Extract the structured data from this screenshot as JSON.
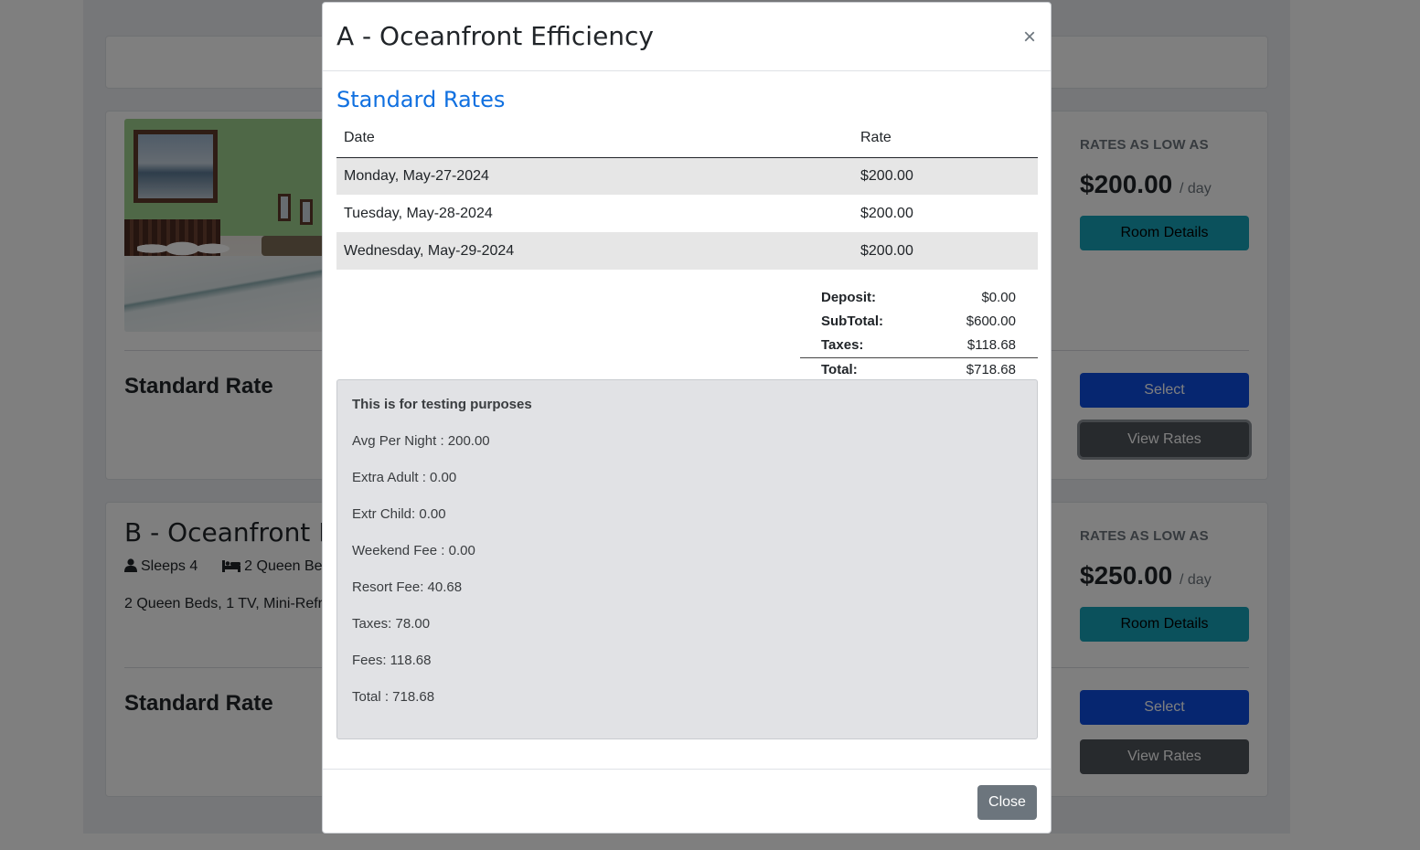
{
  "background": {
    "room_a": {
      "rate_name": "Standard Rate",
      "rates_low_label": "RATES AS LOW AS",
      "price": "$200.00",
      "per": "/ day",
      "room_details_label": "Room Details",
      "select_label": "Select",
      "view_rates_label": "View Rates"
    },
    "room_b": {
      "title": "B - Oceanfront Ro",
      "sleeps": "Sleeps 4",
      "beds": "2 Queen Beds",
      "description": "2 Queen Beds, 1 TV, Mini-Refri",
      "rate_name": "Standard Rate",
      "rates_low_label": "RATES AS LOW AS",
      "price": "$250.00",
      "per": "/ day",
      "room_details_label": "Room Details",
      "select_label": "Select",
      "view_rates_label": "View Rates"
    }
  },
  "modal": {
    "title": "A - Oceanfront Efficiency",
    "close_icon": "×",
    "section_title": "Standard Rates",
    "table": {
      "headers": [
        "Date",
        "Rate"
      ],
      "rows": [
        {
          "date": "Monday, May-27-2024",
          "rate": "$200.00"
        },
        {
          "date": "Tuesday, May-28-2024",
          "rate": "$200.00"
        },
        {
          "date": "Wednesday, May-29-2024",
          "rate": "$200.00"
        }
      ]
    },
    "totals": {
      "deposit_label": "Deposit:",
      "deposit": "$0.00",
      "subtotal_label": "SubTotal:",
      "subtotal": "$600.00",
      "taxes_label": "Taxes:",
      "taxes": "$118.68",
      "total_label": "Total:",
      "total": "$718.68"
    },
    "notes": {
      "heading": "This is for testing purposes",
      "lines": [
        "Avg Per Night : 200.00",
        "Extra Adult : 0.00",
        "Extr Child: 0.00",
        "Weekend Fee : 0.00",
        "Resort Fee: 40.68",
        "Taxes: 78.00",
        "Fees: 118.68",
        "Total : 718.68"
      ]
    },
    "close_button_label": "Close"
  },
  "colors": {
    "section_title": "#1070e0",
    "btn_info": "#17a2b8",
    "btn_primary": "#0d4de0",
    "btn_dark": "#4e545b",
    "btn_secondary": "#6c757d"
  }
}
